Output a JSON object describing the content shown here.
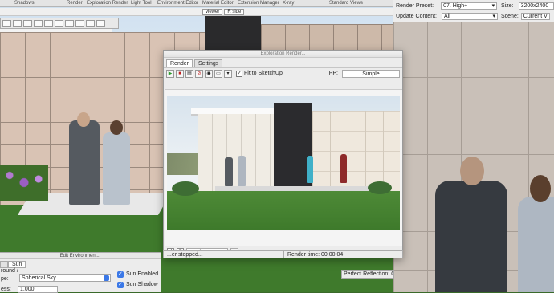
{
  "top_menu": {
    "shadows": "Shadows",
    "render": "Render",
    "exploration_render": "Exploration Render",
    "light_tool": "Light Tool",
    "environment_editor": "Environment Editor",
    "material_editor": "Material Editor",
    "extension_manager": "Extension Manager",
    "xray": "X-ray",
    "standard_views": "Standard Views"
  },
  "viewer_tabs": [
    "viewer",
    "R side"
  ],
  "render_window": {
    "title": "Exploration Render...",
    "tabs": [
      "Render",
      "Settings"
    ],
    "fit_label": "Fit to SketchUp",
    "fit_checkmark": "✓",
    "pp_label": "PP:",
    "pp_value": "Simple",
    "settings_value": "Settings",
    "status_left": "...er stopped...",
    "status_right": "Render time: 00:00:04"
  },
  "render_settings": {
    "preset_label": "Render Preset:",
    "preset_value": "07. High+",
    "size_label": "Size:",
    "size_value": "3200x2400",
    "update_label": "Update Content:",
    "update_value": "All",
    "scene_label": "Scene:",
    "scene_value": "Current V"
  },
  "perfect_reflection": "Perfect Reflection: C",
  "environment": {
    "title": "Edit Environment...",
    "tabs": [
      "",
      "Sun"
    ],
    "background_label": "round /",
    "type_label": "pe:",
    "type_value": "Spherical Sky",
    "brightness_label": "ess:",
    "brightness_value": "1.000",
    "sun_enabled": "Sun Enabled",
    "sun_shadow": "Sun Shadow"
  },
  "colors": {
    "accent": "#3b78e7",
    "play": "#2a9a2a",
    "stop": "#c02020"
  }
}
